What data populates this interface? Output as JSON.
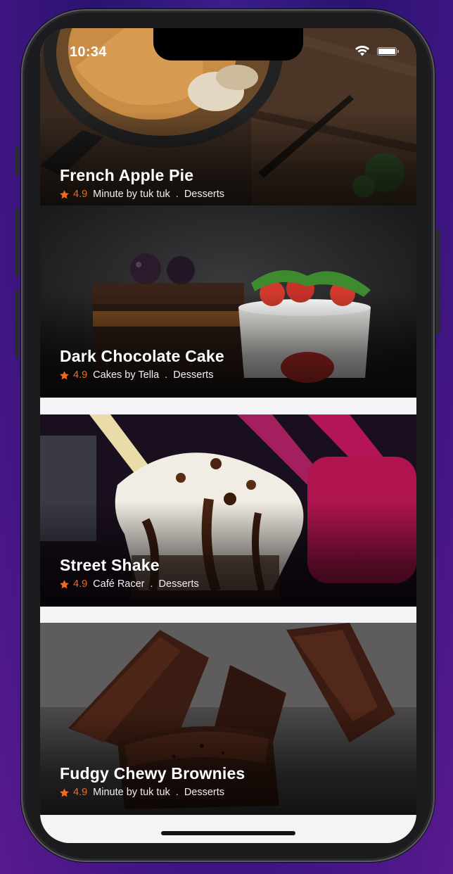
{
  "status": {
    "time": "10:34"
  },
  "colors": {
    "accent": "#f26a21",
    "screen_bg": "#f4f4f6"
  },
  "recipes": [
    {
      "title": "French Apple Pie",
      "rating": "4.9",
      "author": "Minute by tuk tuk",
      "separator": ".",
      "category": "Desserts",
      "icon": "star-icon"
    },
    {
      "title": "Dark Chocolate Cake",
      "rating": "4.9",
      "author": "Cakes by Tella",
      "separator": ".",
      "category": "Desserts",
      "icon": "star-icon"
    },
    {
      "title": "Street Shake",
      "rating": "4.9",
      "author": "Café Racer",
      "separator": ".",
      "category": "Desserts",
      "icon": "star-icon"
    },
    {
      "title": "Fudgy Chewy Brownies",
      "rating": "4.9",
      "author": "Minute by tuk tuk",
      "separator": ".",
      "category": "Desserts",
      "icon": "star-icon"
    }
  ]
}
